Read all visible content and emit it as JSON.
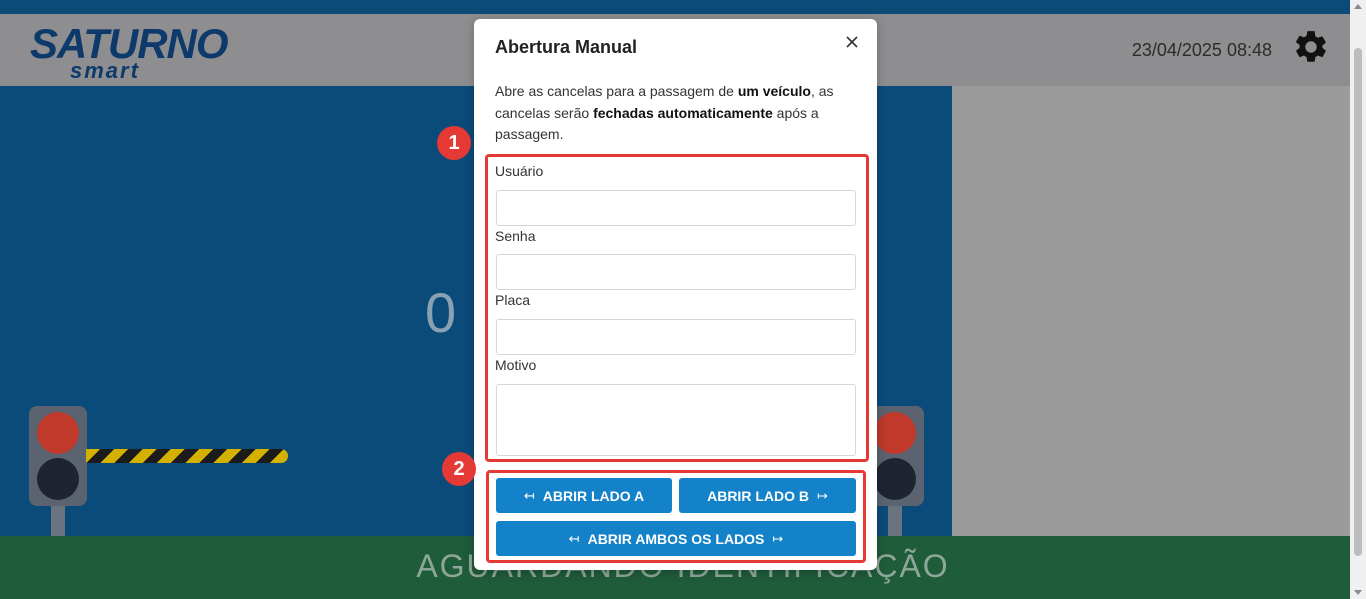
{
  "header": {
    "brand": "SATURNO",
    "brand_sub": "smart",
    "datetime": "23/04/2025 08:48",
    "settings_icon": "gear-icon"
  },
  "main": {
    "counter": "0 I",
    "status": "AGUARDANDO IDENTIFICAÇÃO"
  },
  "modal": {
    "title": "Abertura Manual",
    "close_icon": "close-icon",
    "desc_part1": "Abre as cancelas para a passagem de ",
    "desc_bold1": "um veículo",
    "desc_part2": ", as cancelas serão ",
    "desc_bold2": "fechadas automaticamente",
    "desc_part3": " após a passagem.",
    "fields": {
      "usuario": {
        "label": "Usuário",
        "value": ""
      },
      "senha": {
        "label": "Senha",
        "value": ""
      },
      "placa": {
        "label": "Placa",
        "value": ""
      },
      "motivo": {
        "label": "Motivo",
        "value": ""
      }
    },
    "buttons": {
      "lado_a": {
        "label": "ABRIR LADO A",
        "arrow": "↤"
      },
      "lado_b": {
        "label": "ABRIR LADO B",
        "arrow": "↦"
      },
      "ambos": {
        "label": "ABRIR AMBOS OS LADOS",
        "arrow_left": "↤",
        "arrow_right": "↦"
      }
    }
  },
  "annotations": {
    "badge1": "1",
    "badge2": "2",
    "color": "#e53935"
  },
  "colors": {
    "primary_button": "#1482c8",
    "header_bg": "#8e8e90",
    "main_bg": "#0b4b7a",
    "footer_bg": "#1f5c3a"
  }
}
